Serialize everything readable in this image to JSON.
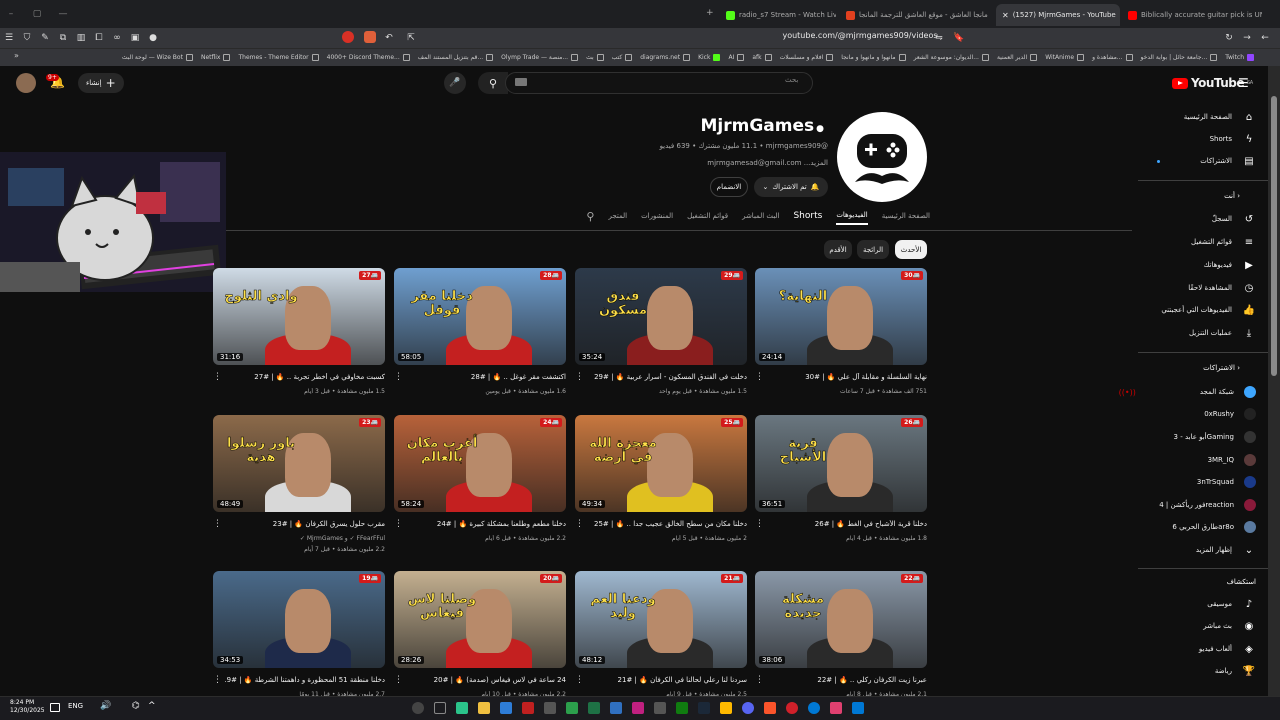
{
  "browser": {
    "tabs": [
      {
        "title": "radio_s7 Stream - Watch Live on Kick",
        "color": "#53fc18"
      },
      {
        "title": "مانجا العاشق - موقع العاشق للترجمة المانجا",
        "color": "#e2401f"
      },
      {
        "title": "(1527) MjrmGames - YouTube",
        "color": "#ff0000",
        "active": true
      },
      {
        "title": "Biblically accurate guitar pick is UNREAL",
        "color": "#ff0000"
      }
    ],
    "url": "youtube.com/@mjrmgames909/videos",
    "bookmarks": [
      "Twitch",
      "جامعة حائل | بوابة الدخو...",
      "مشاهدة و...",
      "WitAnime",
      "الدير العمنية",
      "الديوان: موسوعة الشعر...",
      "مانهوا و مانهوا و مانجا",
      "افلام و مسلسلات",
      "afk",
      "AI",
      "Kick",
      "diagrams.net",
      "كتب",
      "بث",
      "Olymp Trade — منصة...",
      "قم بتنزيل المستند المف...",
      "4000+ Discord Theme...",
      "Themes - Theme Editor",
      "Netflix",
      "لوحة البث — Wize Bot"
    ]
  },
  "masthead": {
    "search_placeholder": "بحث",
    "create_label": "إنشاء",
    "notif_count": "9+",
    "logo_text": "YouTube",
    "logo_region": "SA"
  },
  "channel": {
    "name": "MjrmGames",
    "meta": "@mjrmgames909 • ‏11.1 مليون مشترك • 639 فيديو",
    "desc": "mjrmgamesad@gmail.com ...المزيد",
    "subscribed_label": "تم الاشتراك",
    "join_label": "الانضمام",
    "tabs": [
      "الصفحة الرئيسية",
      "الفيديوهات",
      "Shorts",
      "البث المباشر",
      "قوائم التشغيل",
      "المنشورات",
      "المتجر"
    ],
    "active_tab": "الفيديوهات"
  },
  "chips": [
    {
      "label": "الأحدث",
      "active": true
    },
    {
      "label": "الرائجة",
      "active": false
    },
    {
      "label": "الأقدم",
      "active": false
    }
  ],
  "videos": [
    {
      "title": "نهاية السلسلة و مقابلة آل علي 🔥 | #30",
      "meta": "751 ألف مشاهدة • قبل 7 ساعات",
      "meta2": "",
      "duration": "24:14",
      "num": "30",
      "thumb_text": "النهاية؟",
      "bg": "#6a90b8",
      "shirt": "#2a2a2a"
    },
    {
      "title": "دخلت في الفندق المسكون - أسرار عربية 🔥 | #29",
      "meta": "1.5 مليون مشاهدة • قبل يوم واحد",
      "meta2": "",
      "duration": "35:24",
      "num": "29",
      "thumb_text": "فندق مسكون",
      "bg": "#2d3a4a",
      "shirt": "#8a1e1e"
    },
    {
      "title": "اكتشفت مقر غوغل .. 🔥 | #28",
      "meta": "1.6 مليون مشاهدة • قبل يومين",
      "meta2": "",
      "duration": "58:05",
      "num": "28",
      "thumb_text": "دخلنا مقر قوقل",
      "bg": "#6f9fd0",
      "shirt": "#c42020"
    },
    {
      "title": "كسبت مخاوفي في أخطر تجربة .. 🔥 | #27",
      "meta": "1.5 مليون مشاهدة • قبل 3 أيام",
      "meta2": "",
      "duration": "31:16",
      "num": "27",
      "thumb_text": "وادي الثلوج",
      "bg": "#cfdbe6",
      "shirt": "#c42020"
    },
    {
      "title": "دخلنا قرية الأشباح في الغط 🔥 | #26",
      "meta": "1.8 مليون مشاهدة • قبل 4 أيام",
      "meta2": "",
      "duration": "36:51",
      "num": "26",
      "thumb_text": "قرية الأشباح",
      "bg": "#6a7780",
      "shirt": "#2a2a2a"
    },
    {
      "title": "دخلنا مكان من سطح الخالق عجيب جدا .. 🔥 | #25",
      "meta": "2 مليون مشاهدة • قبل 5 أيام",
      "meta2": "",
      "duration": "49:34",
      "num": "25",
      "thumb_text": "معجزة الله في أرضه",
      "bg": "#c9783f",
      "shirt": "#e0c020"
    },
    {
      "title": "دخلنا مطعم وطلعنا بمشكلة كبيرة 🔥 | #24",
      "meta": "2.2 مليون مشاهدة • قبل 6 أيام",
      "meta2": "",
      "duration": "58:24",
      "num": "24",
      "thumb_text": "أغرب مكان بالعالم",
      "bg": "#b8623a",
      "shirt": "#c42020"
    },
    {
      "title": "مقرب حلول يسرق الكرفان 🔥 | #23",
      "meta": "FFearFFul ✓ و MjrmGames ✓",
      "meta2": "2.2 مليون مشاهدة • قبل 7 أيام",
      "duration": "48:49",
      "num": "23",
      "thumb_text": "باور رسلوا هدية",
      "bg": "#8c6a4a",
      "shirt": "#d8d8d8"
    },
    {
      "title": "عبرنا زيت الكرفان ركلي .. 🔥 | #22",
      "meta": "2.1 مليون مشاهدة • قبل 8 أيام",
      "meta2": "",
      "duration": "38:06",
      "num": "22",
      "thumb_text": "مشكلة جديدة",
      "bg": "#8a98a8",
      "shirt": "#2a2a2a"
    },
    {
      "title": "سردنا لنا رعلي لحالنا في الكرفان 🔥 | #21",
      "meta": "2.5 مليون مشاهدة • قبل 9 أيام",
      "meta2": "",
      "duration": "48:12",
      "num": "21",
      "thumb_text": "ودعنا العم وليد",
      "bg": "#9fb8d0",
      "shirt": "#2a2a2a"
    },
    {
      "title": "24 ساعة في لاس فيغاس (صدمة) 🔥 | #20",
      "meta": "2.2 مليون مشاهدة • قبل 10 أيام",
      "meta2": "",
      "duration": "28:26",
      "num": "20",
      "thumb_text": "وصلنا لاس فيغاس",
      "bg": "#c4b090",
      "shirt": "#c42020"
    },
    {
      "title": "دخلنا منطقة 51 المحظورة و داهمتنا الشرطة 🔥 | #19",
      "meta": "2.7 مليون مشاهدة • قبل 11 يومًا",
      "meta2": "",
      "duration": "34:53",
      "num": "19",
      "thumb_text": "",
      "bg": "#4a6a8a",
      "shirt": "#1e2a4a"
    }
  ],
  "sidebar": {
    "main": [
      {
        "label": "الصفحة الرئيسية",
        "icon": "home-icon"
      },
      {
        "label": "Shorts",
        "icon": "shorts-icon"
      },
      {
        "label": "الاشتراكات",
        "icon": "subscriptions-icon"
      }
    ],
    "you_header": "أنت",
    "you": [
      {
        "label": "السجلّ",
        "icon": "history-icon"
      },
      {
        "label": "قوائم التشغيل",
        "icon": "playlists-icon"
      },
      {
        "label": "فيديوهاتك",
        "icon": "your-videos-icon"
      },
      {
        "label": "المشاهدة لاحقًا",
        "icon": "watch-later-icon"
      },
      {
        "label": "الفيديوهات التي أعجبتني",
        "icon": "liked-icon"
      },
      {
        "label": "عمليات التنزيل",
        "icon": "download-icon"
      }
    ],
    "subs_header": "الاشتراكات",
    "subs": [
      {
        "label": "شبكة المجد",
        "color": "#3ea6ff",
        "live": true
      },
      {
        "label": "0xRushy",
        "color": "#222222"
      },
      {
        "label": "أبو عابد - 3Gaming",
        "color": "#333333"
      },
      {
        "label": "3MR_IQ",
        "color": "#5a3a3a"
      },
      {
        "label": "3nTrSquad",
        "color": "#1a3a8a"
      },
      {
        "label": "فور ريأكشن | 4reaction",
        "color": "#8a1a3a"
      },
      {
        "label": "طارق الحربي 6ar8o",
        "color": "#5a7aa0"
      },
      {
        "label": "إظهار المزيد",
        "icon": "chevron-down-icon"
      }
    ],
    "explore_header": "استكشاف",
    "explore": [
      {
        "label": "موسيقى",
        "icon": "music-icon"
      },
      {
        "label": "بث مباشر",
        "icon": "live-icon"
      },
      {
        "label": "ألعاب فيديو",
        "icon": "gaming-icon"
      },
      {
        "label": "رياضة",
        "icon": "trophy-icon"
      }
    ]
  },
  "taskbar": {
    "time": "8:24 PM",
    "date": "12/30/2025"
  }
}
